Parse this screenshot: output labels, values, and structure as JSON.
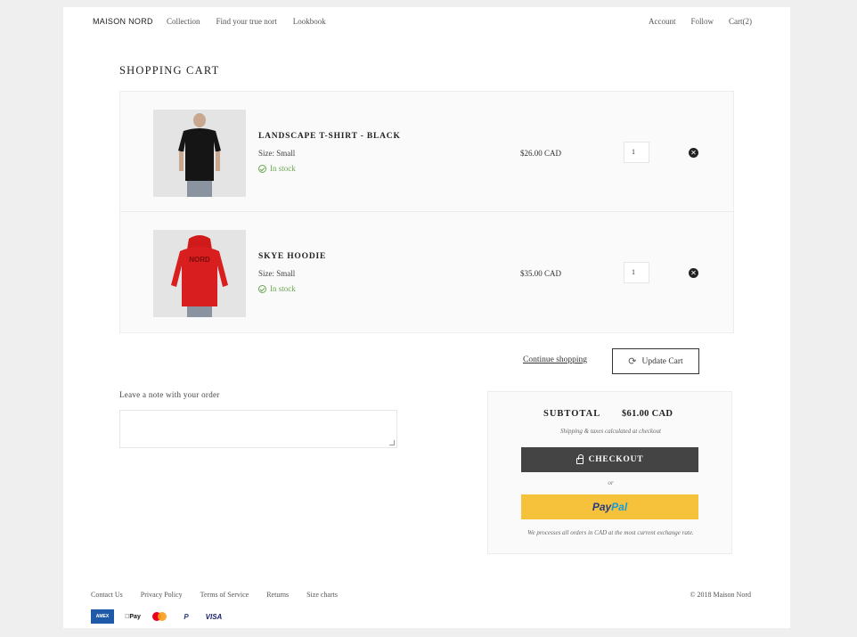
{
  "header": {
    "brand": "MAISON NORD",
    "nav_left": [
      "Collection",
      "Find your true nort",
      "Lookbook"
    ],
    "nav_right": [
      "Account",
      "Follow",
      "Cart(2)"
    ]
  },
  "cart": {
    "title": "SHOPPING CART",
    "items": [
      {
        "name": "LANDSCAPE T-SHIRT - BLACK",
        "size": "Size: Small",
        "stock": "In stock",
        "price": "$26.00 CAD",
        "quantity": "1",
        "image_icon": "black-tshirt-photo"
      },
      {
        "name": "SKYE HOODIE",
        "size": "Size: Small",
        "stock": "In stock",
        "price": "$35.00 CAD",
        "quantity": "1",
        "image_icon": "red-hoodie-photo"
      }
    ],
    "continue_label": "Continue shopping",
    "update_label": "Update Cart"
  },
  "note": {
    "label": "Leave a note with your order",
    "value": ""
  },
  "summary": {
    "subtotal_label": "SUBTOTAL",
    "subtotal_value": "$61.00 CAD",
    "shipping_note": "Shipping & taxes calculated at checkout",
    "checkout_label": "CHECKOUT",
    "or_label": "or",
    "paypal_label_1": "Pay",
    "paypal_label_2": "Pal",
    "exchange_note": "We processes all orders in CAD at the most current exchange rate."
  },
  "footer": {
    "links": [
      "Contact Us",
      "Privacy Policy",
      "Terms of Service",
      "Returns",
      "Size charts"
    ],
    "copyright": "© 2018 Maison Nord",
    "payment_icons": [
      "american-express-icon",
      "apple-pay-icon",
      "mastercard-icon",
      "paypal-icon",
      "visa-icon"
    ],
    "amex_text": "AMEX",
    "applepay_text": "Pay",
    "paypal_text": "P",
    "visa_text": "VISA"
  },
  "colors": {
    "accent_stock": "#6aa84f",
    "checkout_bg": "#444444",
    "paypal_bg": "#f6c23c"
  }
}
